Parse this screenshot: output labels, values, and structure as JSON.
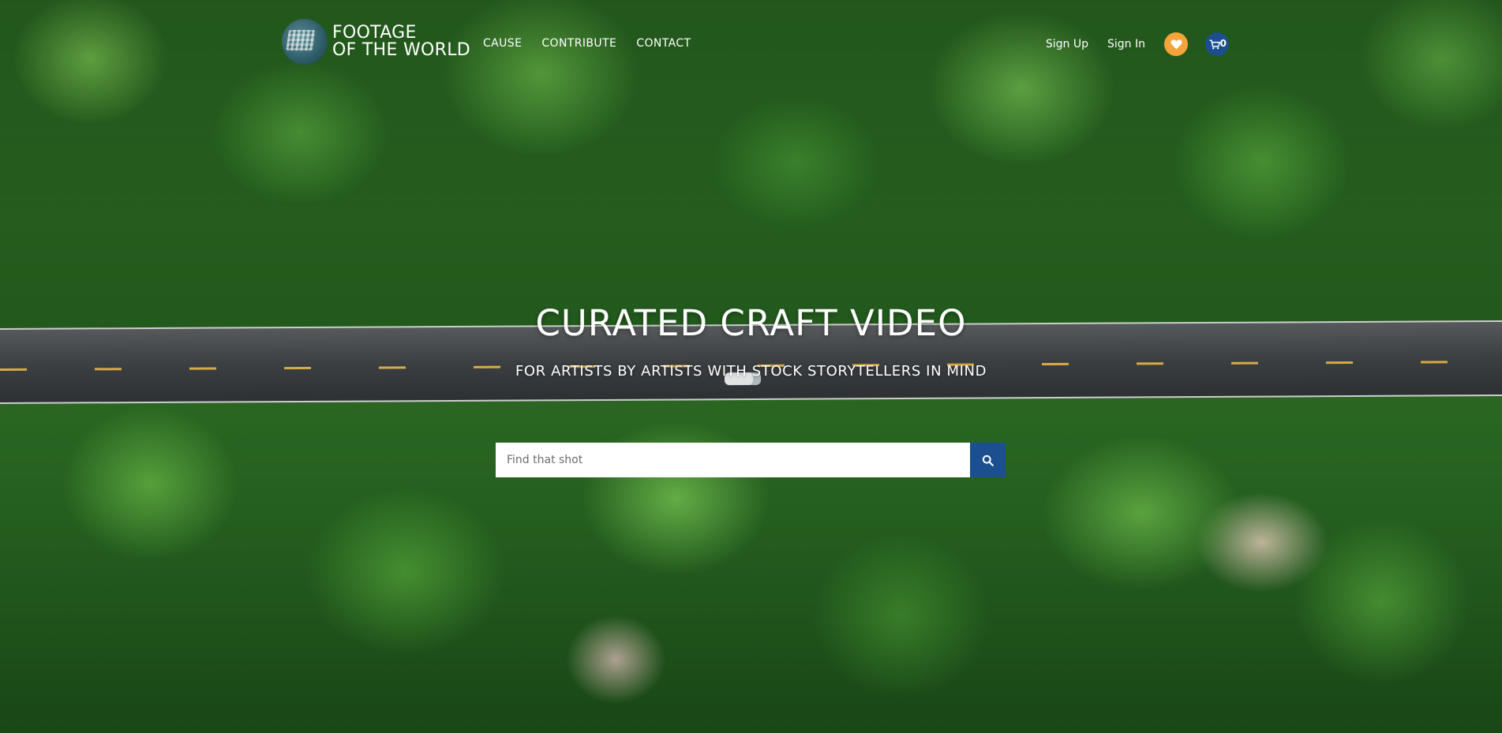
{
  "brand": {
    "logo_line1": "FOOTAGE",
    "logo_line2": "OF THE WORLD",
    "logo_icon": "globe-film-icon"
  },
  "nav": {
    "items": [
      {
        "label": "CAUSE"
      },
      {
        "label": "CONTRIBUTE"
      },
      {
        "label": "CONTACT"
      }
    ]
  },
  "auth": {
    "sign_up": "Sign Up",
    "sign_in": "Sign In",
    "wishlist_icon": "heart-icon",
    "cart_icon": "cart-icon",
    "cart_count": "0"
  },
  "hero": {
    "headline": "CURATED CRAFT VIDEO",
    "subheadline": "FOR ARTISTS BY ARTISTS WITH STOCK STORYTELLERS IN MIND",
    "background": "aerial forest road"
  },
  "search": {
    "placeholder": "Find that shot",
    "button_icon": "search-icon"
  },
  "colors": {
    "accent_blue": "#1b4f8f",
    "wishlist_orange": "#f5a43a",
    "text_white": "#ffffff"
  }
}
